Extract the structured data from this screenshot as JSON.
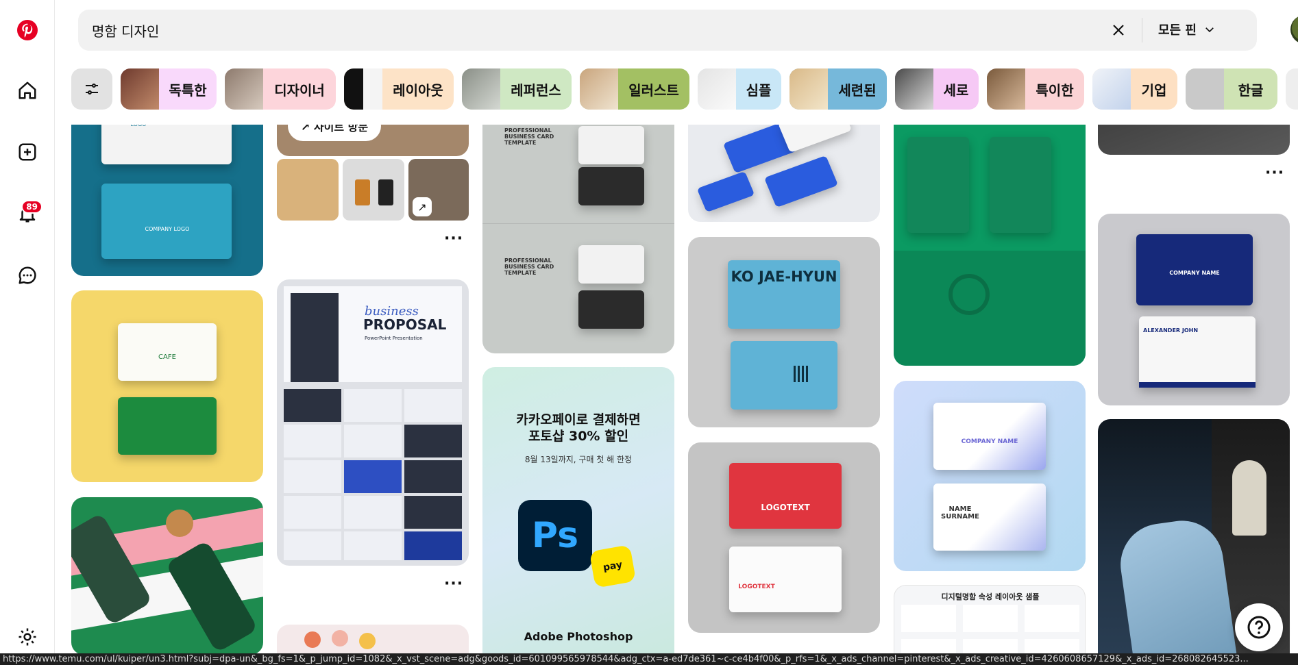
{
  "search": {
    "query": "명함 디자인",
    "scope_label": "모든 핀"
  },
  "sidebar": {
    "notification_count": "89"
  },
  "chips": [
    {
      "label": "독특한",
      "color": "#f9d9fb"
    },
    {
      "label": "디자이너",
      "color": "#fdd5db"
    },
    {
      "label": "레이아웃",
      "color": "#fde3c7"
    },
    {
      "label": "레퍼런스",
      "color": "#cfe8c3"
    },
    {
      "label": "일러스트",
      "color": "#a3c063"
    },
    {
      "label": "심플",
      "color": "#c9e7f7"
    },
    {
      "label": "세련된",
      "color": "#76b8da"
    },
    {
      "label": "세로",
      "color": "#f6c9f5"
    },
    {
      "label": "특이한",
      "color": "#fbd3d5"
    },
    {
      "label": "기업",
      "color": "#fde0c3"
    },
    {
      "label": "한글",
      "color": "#cfe3b4"
    }
  ],
  "pins": {
    "company_logo_top": "COMPANY LOGO",
    "company_logo_bottom": "COMPANY LOGO",
    "site_visit": "↗ 사이트 방문",
    "proposal_word1": "business",
    "proposal_word2": "PROPOSAL",
    "proposal_sub": "PowerPoint Presentation",
    "template_title": "PROFESSIONAL BUSINESS CARD TEMPLATE",
    "ko_name": "KO JAE-HYUN",
    "logotext": "LOGOTEXT",
    "kakao_line1": "카카오페이로 결제하면",
    "kakao_line2": "포토샵 30% 할인",
    "kakao_sub": "8월 13일까지, 구매 첫 해 한정",
    "ps_label": "Ps",
    "pay_label": "pay",
    "adobe_label": "Adobe Photoshop",
    "company_name": "COMPANY NAME",
    "name_surname": "NAME SURNAME",
    "alexander": "ALEXANDER JOHN",
    "company_name_blue": "COMPANY NAME",
    "digital_card_title": "디지털명함 속성 레이아웃 샘플",
    "cafe_text": "CAFE"
  },
  "status_url": "https://www.temu.com/ul/kuiper/un3.html?subj=dpa-un&_bg_fs=1&_p_jump_id=1082&_x_vst_scene=adg&goods_id=601099565978544&adg_ctx=a-ed7de361~c-ce4b4f00&_p_rfs=1&_x_ads_channel=pinterest&_x_ads_creative_id=4260608657129&_x_ads_id=268082645523..."
}
